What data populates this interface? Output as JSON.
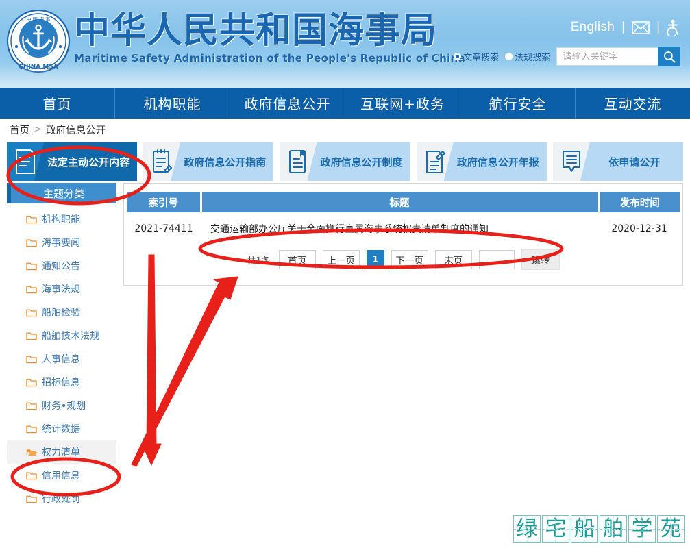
{
  "header": {
    "logo_text_top": "中 国 海 事",
    "logo_text_bottom": "CHINA MSA",
    "title_cn": "中华人民共和国海事局",
    "title_en": "Maritime Safety Administration of the People's Republic of China",
    "english_link": "English",
    "divider": "|",
    "mail_icon": "mail-icon",
    "accessibility_icon": "accessibility-icon",
    "search": {
      "options": [
        {
          "label": "文章搜索",
          "checked": true
        },
        {
          "label": "法规搜索",
          "checked": false
        }
      ],
      "placeholder": "请输入关键字",
      "value": "",
      "button_icon": "search-icon"
    }
  },
  "nav": {
    "items": [
      {
        "label": "首页"
      },
      {
        "label": "机构职能"
      },
      {
        "label": "政府信息公开"
      },
      {
        "label": "互联网+政务"
      },
      {
        "label": "航行安全"
      },
      {
        "label": "互动交流"
      }
    ]
  },
  "breadcrumb": {
    "home": "首页",
    "separator": ">",
    "current": "政府信息公开"
  },
  "tabs": [
    {
      "label": "法定主动公开内容",
      "icon": "document-icon",
      "active": true
    },
    {
      "label": "政府信息公开指南",
      "icon": "clipboard-pen-icon",
      "active": false
    },
    {
      "label": "政府信息公开制度",
      "icon": "document-bookmark-icon",
      "active": false
    },
    {
      "label": "政府信息公开年报",
      "icon": "document-edit-icon",
      "active": false
    },
    {
      "label": "依申请公开",
      "icon": "speech-bubble-icon",
      "active": false
    }
  ],
  "sidebar": {
    "header": "主题分类",
    "items": [
      {
        "label": "机构职能",
        "icon": "folder-icon",
        "selected": false
      },
      {
        "label": "海事要闻",
        "icon": "folder-icon",
        "selected": false
      },
      {
        "label": "通知公告",
        "icon": "folder-icon",
        "selected": false
      },
      {
        "label": "海事法规",
        "icon": "folder-icon",
        "selected": false
      },
      {
        "label": "船舶检验",
        "icon": "folder-icon",
        "selected": false
      },
      {
        "label": "船舶技术法规",
        "icon": "folder-icon",
        "selected": false
      },
      {
        "label": "人事信息",
        "icon": "folder-icon",
        "selected": false
      },
      {
        "label": "招标信息",
        "icon": "folder-icon",
        "selected": false
      },
      {
        "label": "财务•规划",
        "icon": "folder-icon",
        "selected": false
      },
      {
        "label": "统计数据",
        "icon": "folder-icon",
        "selected": false
      },
      {
        "label": "权力清单",
        "icon": "folder-open-icon",
        "selected": true
      },
      {
        "label": "信用信息",
        "icon": "folder-icon",
        "selected": false
      },
      {
        "label": "行政处罚",
        "icon": "folder-icon",
        "selected": false
      }
    ]
  },
  "table": {
    "columns": [
      "索引号",
      "标题",
      "发布时间"
    ],
    "rows": [
      {
        "index": "2021-74411",
        "title": "交通运输部办公厅关于全面推行直属海事系统权责清单制度的通知",
        "date": "2020-12-31"
      }
    ]
  },
  "pagination": {
    "total_label": "共1条",
    "first": "首页",
    "prev": "上一页",
    "current_page": "1",
    "next": "下一页",
    "last": "末页",
    "jump_value": "",
    "jump_button": "跳转"
  },
  "watermark": {
    "characters": [
      "绿",
      "宅",
      "船",
      "舶",
      "学",
      "苑"
    ]
  },
  "colors": {
    "nav_blue": "#0b5ea8",
    "tab_active": "#1069ab",
    "tab_inactive": "#b7d9f4",
    "table_header": "#4a90cc",
    "annotation_red": "#e8201a",
    "watermark_teal": "#1a9c97",
    "sidebar_link": "#3b79b8",
    "folder_orange": "#f08c28"
  }
}
